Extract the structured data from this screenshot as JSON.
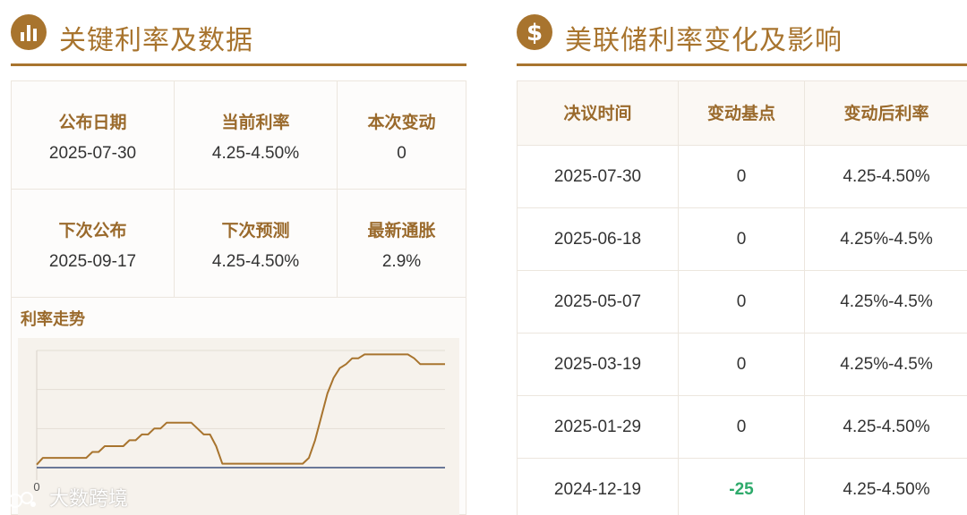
{
  "left_section": {
    "icon": "bar-chart-icon",
    "title": "关键利率及数据",
    "cells": [
      {
        "label": "公布日期",
        "value": "2025-07-30"
      },
      {
        "label": "当前利率",
        "value": "4.25-4.50%"
      },
      {
        "label": "本次变动",
        "value": "0"
      },
      {
        "label": "下次公布",
        "value": "2025-09-17"
      },
      {
        "label": "下次预测",
        "value": "4.25-4.50%"
      },
      {
        "label": "最新通胀",
        "value": "2.9%"
      }
    ],
    "trend_title": "利率走势"
  },
  "right_section": {
    "icon": "dollar-icon",
    "title": "美联储利率变化及影响",
    "headers": [
      "决议时间",
      "变动基点",
      "变动后利率"
    ],
    "rows": [
      [
        "2025-07-30",
        "0",
        "4.25-4.50%"
      ],
      [
        "2025-06-18",
        "0",
        "4.25%-4.5%"
      ],
      [
        "2025-05-07",
        "0",
        "4.25%-4.5%"
      ],
      [
        "2025-03-19",
        "0",
        "4.25%-4.5%"
      ],
      [
        "2025-01-29",
        "0",
        "4.25-4.50%"
      ],
      [
        "2024-12-19",
        "-25",
        "4.25-4.50%"
      ]
    ]
  },
  "chart_data": {
    "type": "line",
    "xlabel": "",
    "ylabel": "",
    "x_tick_labels": [
      "0"
    ],
    "ylim": [
      0,
      6
    ],
    "grid": true,
    "series": [
      {
        "color": "#a8742e",
        "values": [
          0.15,
          0.5,
          0.5,
          0.5,
          0.5,
          0.5,
          0.5,
          0.5,
          0.5,
          0.8,
          0.8,
          1.1,
          1.1,
          1.1,
          1.1,
          1.4,
          1.4,
          1.7,
          1.7,
          2.0,
          2.0,
          2.3,
          2.3,
          2.3,
          2.3,
          2.3,
          2.0,
          1.7,
          1.7,
          1.1,
          0.2,
          0.2,
          0.2,
          0.2,
          0.2,
          0.2,
          0.2,
          0.2,
          0.2,
          0.2,
          0.2,
          0.2,
          0.2,
          0.2,
          0.5,
          1.4,
          2.6,
          3.8,
          4.6,
          5.1,
          5.3,
          5.6,
          5.6,
          5.8,
          5.8,
          5.8,
          5.8,
          5.8,
          5.8,
          5.8,
          5.8,
          5.6,
          5.3,
          5.3,
          5.3,
          5.3,
          5.3
        ]
      },
      {
        "color": "#3c4f7c",
        "values": [
          0,
          0,
          0,
          0,
          0,
          0,
          0,
          0,
          0,
          0,
          0,
          0,
          0,
          0,
          0,
          0,
          0,
          0,
          0,
          0,
          0,
          0,
          0,
          0,
          0,
          0,
          0,
          0,
          0,
          0,
          0,
          0,
          0,
          0,
          0,
          0,
          0,
          0,
          0,
          0,
          0,
          0,
          0,
          0,
          0,
          0,
          0,
          0,
          0,
          0,
          0,
          0,
          0,
          0,
          0,
          0,
          0,
          0,
          0,
          0,
          0,
          0,
          0,
          0,
          0,
          0,
          0
        ]
      }
    ]
  },
  "watermark": {
    "icon": "logo-icon",
    "text": "大数跨境"
  },
  "colors": {
    "accent": "#a8742e",
    "negative_change": "#2eaa6b",
    "baseline": "#3c4f7c"
  }
}
